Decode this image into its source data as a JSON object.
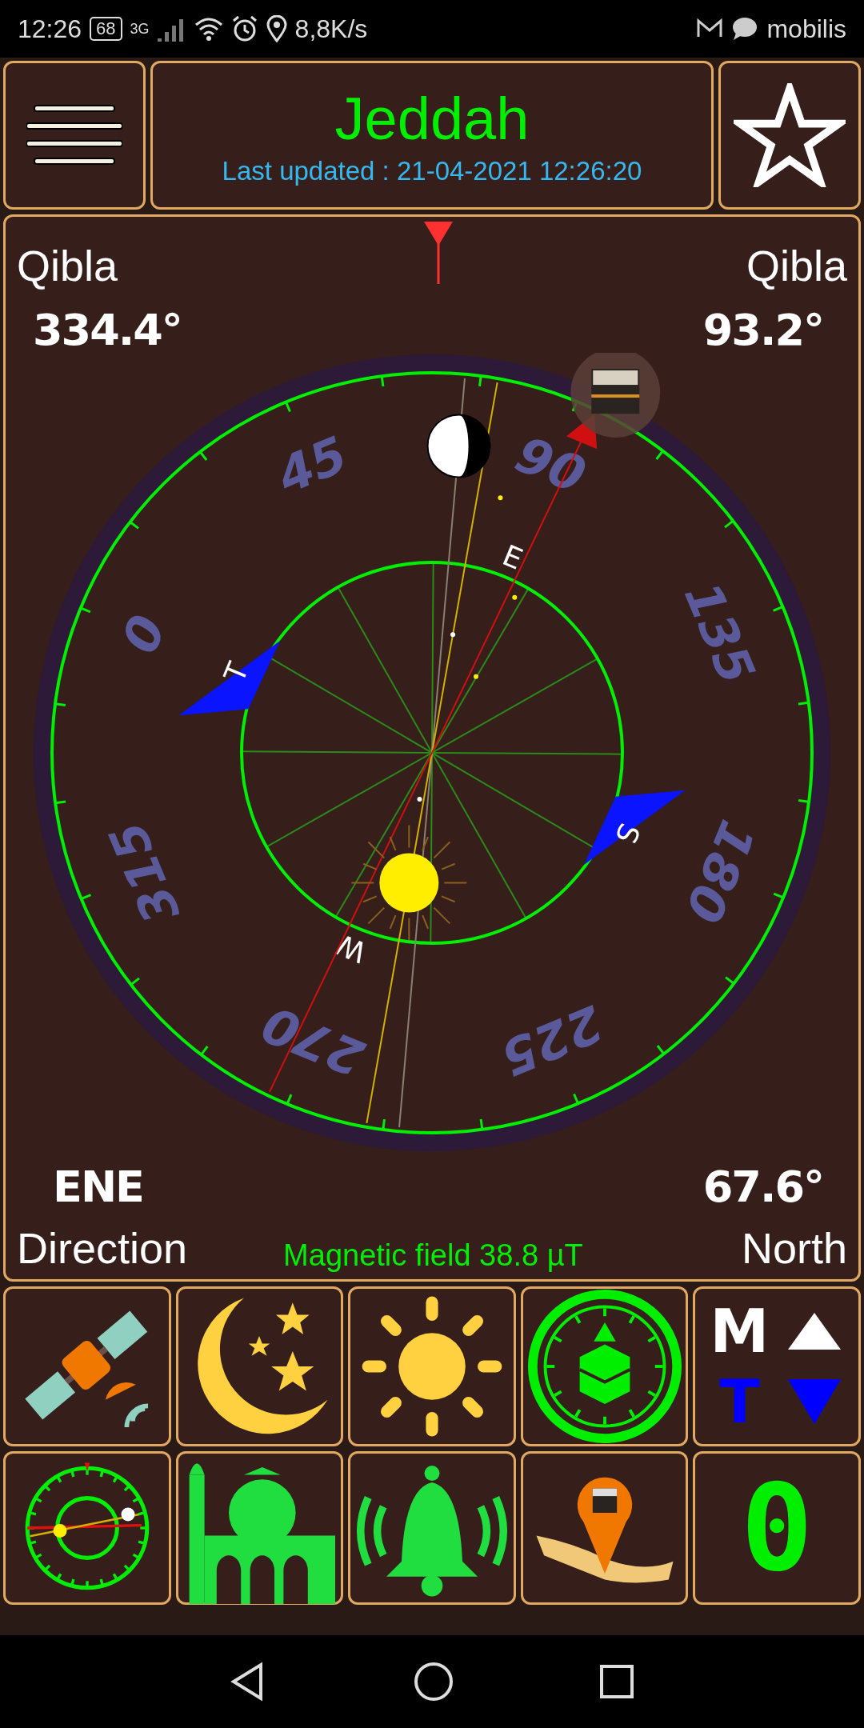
{
  "status_bar": {
    "time": "12:26",
    "battery": "68",
    "network": "3G",
    "speed": "8,8K/s",
    "carrier": "mobilis"
  },
  "header": {
    "city": "Jeddah",
    "updated": "Last updated : 21-04-2021 12:26:20"
  },
  "compass": {
    "top_left": {
      "label": "Qibla",
      "value": "334.4°"
    },
    "top_right": {
      "label": "Qibla",
      "value": "93.2°"
    },
    "bottom_left": {
      "value": "ENE",
      "label": "Direction"
    },
    "bottom_right": {
      "value": "67.6°",
      "label": "North"
    },
    "magnetic_field": "Magnetic field 38.8 µT",
    "dial_labels": [
      "0",
      "45",
      "90",
      "135",
      "180",
      "225",
      "270",
      "315"
    ],
    "markers": [
      {
        "text": "T",
        "kind": "flag"
      },
      {
        "text": "E",
        "kind": "letter"
      },
      {
        "text": "S",
        "kind": "flag"
      },
      {
        "text": "W",
        "kind": "letter"
      }
    ]
  },
  "tools_row_1": [
    {
      "kind": "satellite"
    },
    {
      "kind": "moon"
    },
    {
      "kind": "sun"
    },
    {
      "kind": "kaaba-compass"
    },
    {
      "kind": "mode",
      "letters": [
        "M",
        "T"
      ]
    }
  ],
  "tools_row_2": [
    {
      "kind": "mini-compass"
    },
    {
      "kind": "mosque"
    },
    {
      "kind": "bell"
    },
    {
      "kind": "map-pin"
    },
    {
      "kind": "digit",
      "text": "0"
    }
  ]
}
